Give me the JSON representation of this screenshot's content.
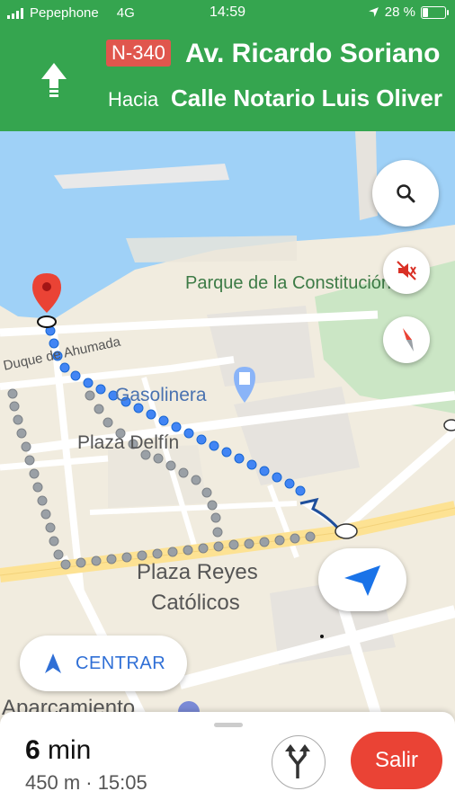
{
  "status_bar": {
    "carrier": "Pepephone",
    "network": "4G",
    "time": "14:59",
    "battery": "28 %",
    "battery_level": 0.28
  },
  "nav_header": {
    "direction_icon": "straight-arrow-icon",
    "route_badge": "N-340",
    "street": "Av. Ricardo Soriano",
    "toward_label": "Hacia",
    "toward_street": "Calle Notario Luis Oliver"
  },
  "map": {
    "labels": {
      "park": "Parque de la Constitución",
      "street_duque": "Duque de Ahumada",
      "gas_station": "Gasolinera",
      "plaza_delfin": "Plaza Delfín",
      "plaza_reyes_line1": "Plaza Reyes",
      "plaza_reyes_line2": "Católicos",
      "parking": "Aparcamiento"
    },
    "colors": {
      "water": "#9fd1f7",
      "land": "#f1ecdf",
      "park": "#cbe6c5",
      "main_road": "#fde293",
      "route": "#4285f4",
      "alt_route": "#9aa0a6"
    }
  },
  "controls": {
    "search_icon": "search-icon",
    "mute_icon": "sound-off-icon",
    "compass_icon": "compass-icon",
    "recenter_icon": "navigation-arrow-icon",
    "centrar_label": "CENTRAR"
  },
  "bottom_panel": {
    "eta_minutes": "6",
    "eta_unit": "min",
    "details": "450 m · 15:05",
    "alternate_routes_icon": "alt-route-icon",
    "exit_label": "Salir"
  }
}
